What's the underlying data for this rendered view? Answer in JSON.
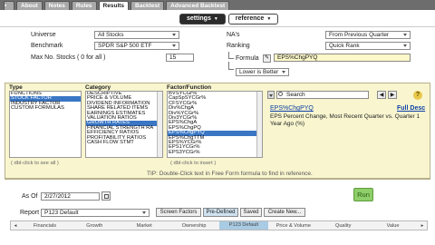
{
  "tabs": [
    {
      "label": ""
    },
    {
      "label": "About"
    },
    {
      "label": "Notes"
    },
    {
      "label": "Rules"
    },
    {
      "label": "Results"
    },
    {
      "label": "Backtest"
    },
    {
      "label": "Advanced Backtest"
    }
  ],
  "subtabs": {
    "settings": "settings",
    "reference": "reference"
  },
  "form": {
    "universe_label": "Universe",
    "universe_value": "All Stocks",
    "benchmark_label": "Benchmark",
    "benchmark_value": "SPDR S&P 500 ETF",
    "maxno_label": "Max No. Stocks ( 0 for all )",
    "maxno_value": "15",
    "nas_label": "NA's",
    "nas_value": "From Previous Quarter",
    "ranking_label": "Ranking",
    "ranking_value": "Quick Rank",
    "formula_label": "Formula",
    "formula_value": "EPS%ChgPYQ",
    "order_value": "Lower is Better"
  },
  "panel": {
    "type_header": "Type",
    "category_header": "Category",
    "factor_header": "Factor/Function",
    "types": [
      "FUNCTIONS",
      "STOCK FACTOR",
      "INDUSTRY FACTOR",
      "CUSTOM FORMULAS"
    ],
    "categories": [
      "DESCRIPTIVE",
      "PRICE & VOLUME",
      "DIVIDEND INFORMATION",
      "SHARE RELATED ITEMS",
      "EARNINGS ESTIMATES",
      "VALUATION RATIOS",
      "GROWTH RATES",
      "FINANCIAL STRENGTH RA",
      "EFFICIENCY RATIOS",
      "PROFITABILITY RATIOS",
      "CASH FLOW STMT"
    ],
    "factors": [
      "BVSYCGr%",
      "CapSpSYCGr%",
      "CFSYCGr%",
      "Div%ChgA",
      "Div%YCGr%",
      "Div3YCGr%",
      "EPS%ChgA",
      "EPS%ChgPQ",
      "EPS%ChgPYQ",
      "EPS%ChgTTM",
      "EPS%YCGr%",
      "EPS1YCGr%",
      "EPS3YCGr%"
    ],
    "search_placeholder": "Search",
    "desc_name": "EPS%ChgPYQ",
    "desc_full": "Full Desc",
    "desc_text": "EPS Percent Change, Most Recent Quarter vs. Quarter 1 Year Ago (%)",
    "dbl_note_1": "( dbl-click to see all )",
    "dbl_note_2": "( dbl-click to insert )",
    "tip": "TIP: Double-Click text in Free Form formula to find in reference."
  },
  "asof": {
    "label": "As Of",
    "value": "2/27/2012"
  },
  "run_label": "Run",
  "report": {
    "label": "Report",
    "value": "P123 Default",
    "buttons": [
      "Screen Factors",
      "Pre-Defined",
      "Saved",
      "Create New..."
    ]
  },
  "bottom_nav": [
    "Financials",
    "Growth",
    "Market",
    "Ownership",
    "P123 Default",
    "Price & Volume",
    "Quality",
    "Value"
  ]
}
